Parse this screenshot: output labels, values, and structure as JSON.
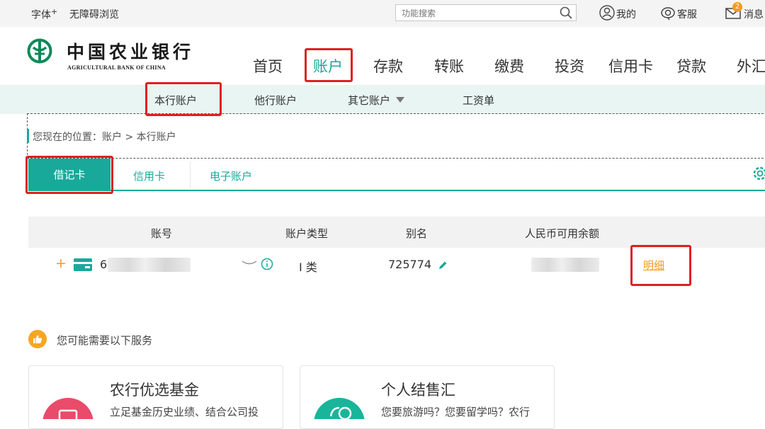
{
  "topbar": {
    "font_label": "字体",
    "font_sup": "+",
    "accessible_label": "无障碍浏览",
    "search_placeholder": "功能搜索",
    "mine_label": "我的",
    "service_label": "客服",
    "message_label": "消息",
    "message_count": "2"
  },
  "logo": {
    "cn": "中国农业银行",
    "en": "AGRICULTURAL BANK OF CHINA"
  },
  "nav": {
    "items": [
      "首页",
      "账户",
      "存款",
      "转账",
      "缴费",
      "投资",
      "信用卡",
      "贷款",
      "外汇"
    ],
    "active": "账户"
  },
  "subnav": {
    "items": [
      "本行账户",
      "他行账户",
      "其它账户",
      "工资单"
    ],
    "active": "本行账户"
  },
  "breadcrumb": "您现在的位置：账户 > 本行账户",
  "card_tabs": {
    "items": [
      "借记卡",
      "信用卡",
      "电子账户"
    ],
    "active": "借记卡"
  },
  "table": {
    "headers": [
      "账号",
      "账户类型",
      "别名",
      "人民币可用余额"
    ],
    "rows": [
      {
        "expand": "+",
        "account_prefix": "6",
        "type": "I 类",
        "alias": "725774",
        "action": "明细"
      }
    ]
  },
  "services": {
    "title": "您可能需要以下服务",
    "cards": [
      {
        "title": "农行优选基金",
        "desc": "立足基金历史业绩、结合公司投"
      },
      {
        "title": "个人结售汇",
        "desc": "您要旅游吗？您要留学吗？农行"
      }
    ]
  },
  "colors": {
    "accent": "#19a99b",
    "highlight": "#e02020",
    "link": "#f39a1e"
  }
}
